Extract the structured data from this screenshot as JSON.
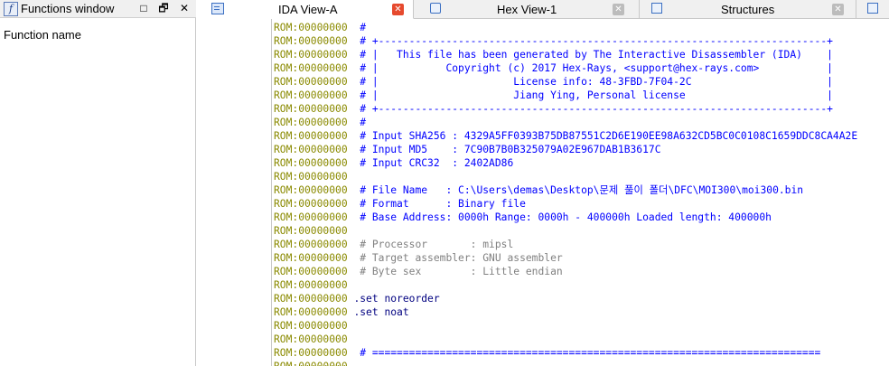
{
  "functions_window": {
    "title": "Functions window",
    "icon": "f",
    "column_header": "Function name",
    "buttons": [
      "□",
      "🗗",
      "✕"
    ]
  },
  "tabs": [
    {
      "label": "IDA View-A",
      "close": "✕",
      "active": true,
      "icon": "ida-view-icon"
    },
    {
      "label": "Hex View-1",
      "close": "✕",
      "active": false,
      "icon": "hex-view-icon"
    },
    {
      "label": "Structures",
      "close": "✕",
      "active": false,
      "icon": "structures-icon"
    }
  ],
  "listing": {
    "address": "ROM:00000000",
    "lines": [
      {
        "t": "#",
        "c": "blue"
      },
      {
        "t": "# +-------------------------------------------------------------------------+",
        "c": "blue"
      },
      {
        "t": "# |   This file has been generated by The Interactive Disassembler (IDA)    |",
        "c": "blue"
      },
      {
        "t": "# |           Copyright (c) 2017 Hex-Rays, <support@hex-rays.com>           |",
        "c": "blue"
      },
      {
        "t": "# |                      License info: 48-3FBD-7F04-2C                      |",
        "c": "blue"
      },
      {
        "t": "# |                      Jiang Ying, Personal license                       |",
        "c": "blue"
      },
      {
        "t": "# +-------------------------------------------------------------------------+",
        "c": "blue"
      },
      {
        "t": "#",
        "c": "blue"
      },
      {
        "t": "# Input SHA256 : 4329A5FF0393B75DB87551C2D6E190EE98A632CD5BC0C0108C1659DDC8CA4A2E",
        "c": "blue"
      },
      {
        "t": "# Input MD5    : 7C90B7B0B325079A02E967DAB1B3617C",
        "c": "blue"
      },
      {
        "t": "# Input CRC32  : 2402AD86",
        "c": "blue"
      },
      {
        "t": "",
        "c": "blue"
      },
      {
        "t": "# File Name   : C:\\Users\\demas\\Desktop\\문제 풀이 폴더\\DFC\\MOI300\\moi300.bin",
        "c": "blue"
      },
      {
        "t": "# Format      : Binary file",
        "c": "blue"
      },
      {
        "t": "# Base Address: 0000h Range: 0000h - 400000h Loaded length: 400000h",
        "c": "blue"
      },
      {
        "t": "",
        "c": "blue"
      },
      {
        "t": "# Processor       : mipsl",
        "c": "grey"
      },
      {
        "t": "# Target assembler: GNU assembler",
        "c": "grey"
      },
      {
        "t": "# Byte sex        : Little endian",
        "c": "grey"
      },
      {
        "t": "",
        "c": "blue"
      },
      {
        "t": ".set noreorder",
        "c": "navy"
      },
      {
        "t": ".set noat",
        "c": "navy"
      },
      {
        "t": "",
        "c": "blue"
      },
      {
        "t": "",
        "c": "blue"
      },
      {
        "t": "# =========================================================================",
        "c": "blue"
      },
      {
        "t": "",
        "c": "blue"
      }
    ]
  }
}
